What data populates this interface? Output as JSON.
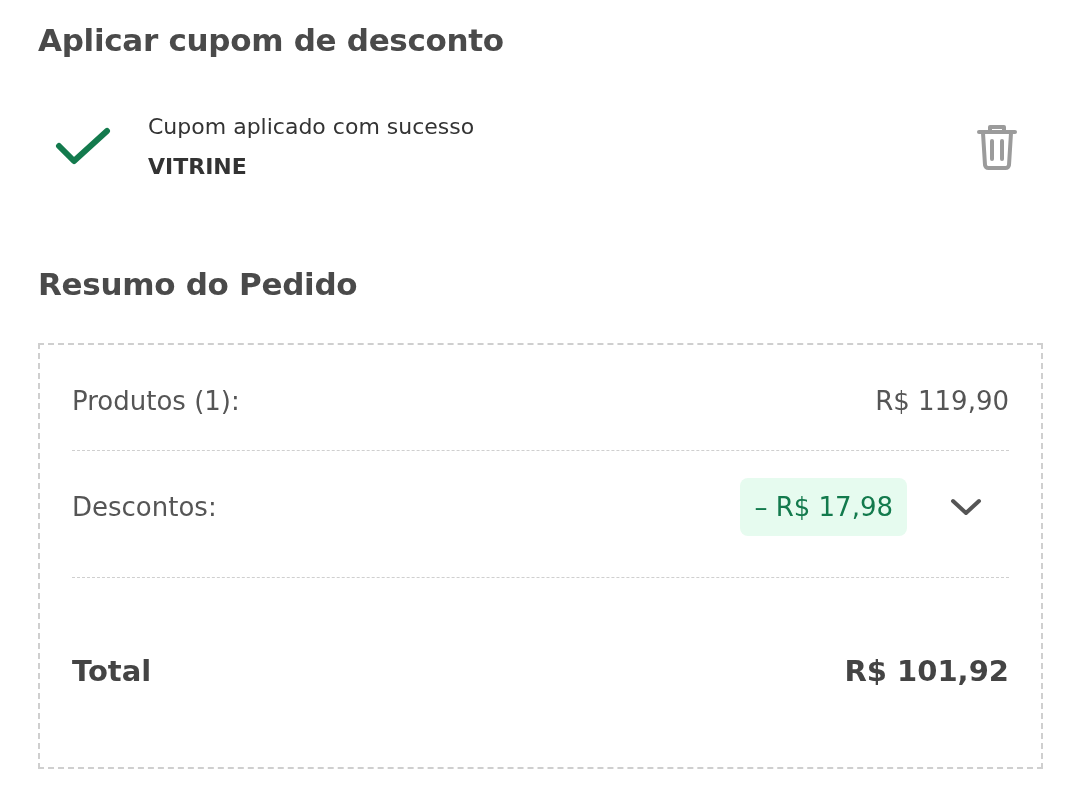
{
  "coupon_section": {
    "title": "Aplicar cupom de desconto",
    "status": "Cupom aplicado com sucesso",
    "code": "VITRINE"
  },
  "order_summary": {
    "title": "Resumo do Pedido",
    "rows": [
      {
        "kind": "line",
        "label": "Produtos (1):",
        "value": "R$ 119,90"
      },
      {
        "kind": "discount",
        "label": "Descontos:",
        "value": "– R$ 17,98",
        "expanded": false
      },
      {
        "kind": "total",
        "label": "Total",
        "value": "R$ 101,92"
      }
    ]
  }
}
